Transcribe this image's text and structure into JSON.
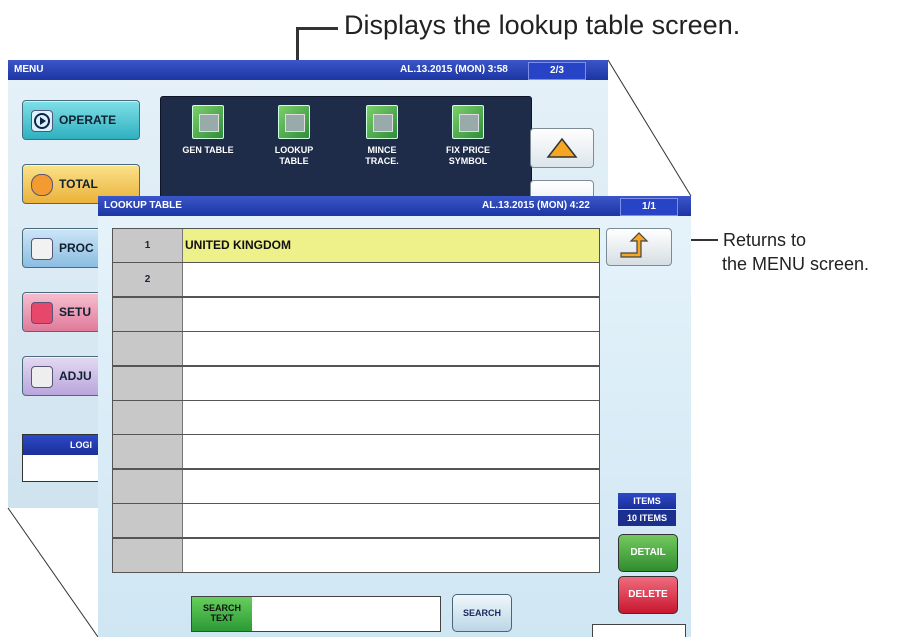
{
  "annotations": {
    "top_callout": "Displays the lookup table screen.",
    "right_callout_line1": "Returns to",
    "right_callout_line2": "the MENU screen."
  },
  "menu_window": {
    "title": "MENU",
    "datetime": "AL.13.2015 (MON)  3:58",
    "page": "2/3",
    "left_buttons": [
      {
        "label": "OPERATE",
        "color": "#47c3cf"
      },
      {
        "label": "TOTAL",
        "color": "#f3c24b"
      },
      {
        "label": "PROC",
        "color": "#9ec7e8"
      },
      {
        "label": "SETU",
        "color": "#e98aa9"
      },
      {
        "label": "ADJU",
        "color": "#c9b7e3"
      }
    ],
    "tiles": [
      {
        "line1": "GEN TABLE",
        "line2": ""
      },
      {
        "line1": "LOOKUP",
        "line2": "TABLE"
      },
      {
        "line1": "MINCE",
        "line2": "TRACE."
      },
      {
        "line1": "FIX PRICE",
        "line2": "SYMBOL"
      }
    ],
    "login_label": "LOGI"
  },
  "lookup_window": {
    "title": "LOOKUP TABLE",
    "datetime": "AL.13.2015 (MON)  4:22",
    "page": "1/1",
    "rows": [
      {
        "no": "1",
        "name": "UNITED KINGDOM",
        "highlight": true
      },
      {
        "no": "2",
        "name": "",
        "highlight": false
      },
      {
        "no": "",
        "name": "",
        "highlight": false
      },
      {
        "no": "",
        "name": "",
        "highlight": false
      },
      {
        "no": "",
        "name": "",
        "highlight": false
      },
      {
        "no": "",
        "name": "",
        "highlight": false
      },
      {
        "no": "",
        "name": "",
        "highlight": false
      },
      {
        "no": "",
        "name": "",
        "highlight": false
      },
      {
        "no": "",
        "name": "",
        "highlight": false
      },
      {
        "no": "",
        "name": "",
        "highlight": false
      }
    ],
    "items_label": "ITEMS",
    "items_value": "10 ITEMS",
    "detail_label": "DETAIL",
    "delete_label": "DELETE",
    "search_text_label_1": "SEARCH",
    "search_text_label_2": "TEXT",
    "search_value": "",
    "search_button": "SEARCH",
    "colors": {
      "highlight_row": "#eef08a",
      "detail": "#4aa640",
      "delete": "#e2344d",
      "search_label_bg": "#3fb04a"
    }
  }
}
